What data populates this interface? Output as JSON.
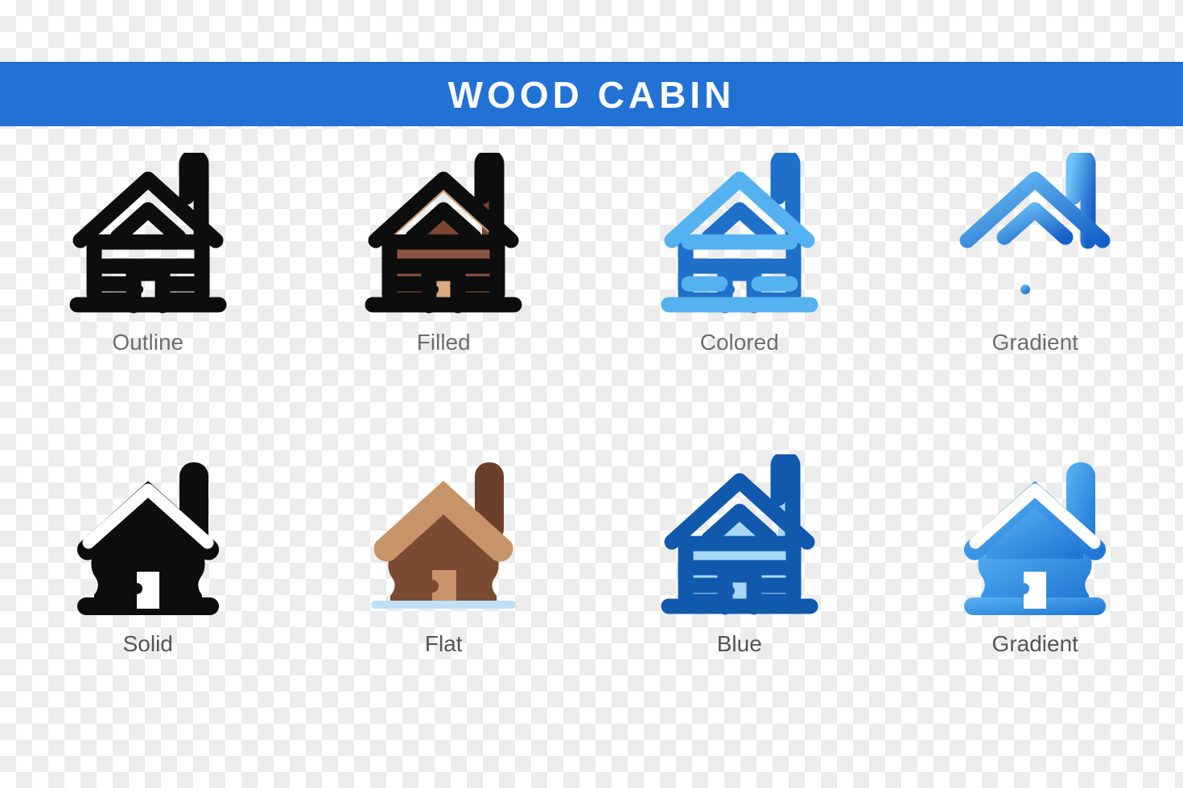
{
  "banner": {
    "title": "WOOD CABIN",
    "background_color": "#2272d6",
    "text_color": "#fdfdfd"
  },
  "background": {
    "type": "transparency-checkerboard",
    "light_color": "#ffffff",
    "dark_color": "#ececec",
    "square_size_px": 20
  },
  "icon_subject": "wood cabin",
  "grid": {
    "columns": 4,
    "rows": 2,
    "variants": [
      {
        "label": "Outline",
        "name": "wood-cabin-outline-icon",
        "stroke": "#0d0d0d",
        "fill": "none",
        "accent": "#0d0d0d"
      },
      {
        "label": "Filled",
        "name": "wood-cabin-filled-icon",
        "stroke": "#0d0d0d",
        "roof_fill": "#cb9a6e",
        "body_fill": "#8a5540",
        "chimney_fill": "#7a4631",
        "door_fill": "#d9ab7e"
      },
      {
        "label": "Colored",
        "name": "wood-cabin-colored-icon",
        "stroke": "#55b2f0",
        "accent": "#1f70c8",
        "fill": "none"
      },
      {
        "label": "Gradient",
        "name": "wood-cabin-gradient-outline-icon",
        "gradient_from": "#6ec2f5",
        "gradient_to": "#1560c8",
        "fill": "none"
      },
      {
        "label": "Solid",
        "name": "wood-cabin-solid-icon",
        "fill": "#0d0d0d",
        "cutout": "#ffffff"
      },
      {
        "label": "Flat",
        "name": "wood-cabin-flat-icon",
        "roof_fill": "#c69468",
        "body_fill": "#7a4a32",
        "chimney_fill": "#6b3f2a",
        "door_fill": "#c69468",
        "ground_fill": "#bfe0f7"
      },
      {
        "label": "Blue",
        "name": "wood-cabin-blue-icon",
        "stroke": "#1159ac",
        "fill": "#a8d8f8"
      },
      {
        "label": "Gradient",
        "name": "wood-cabin-gradient-solid-icon",
        "gradient_from": "#5ab4f2",
        "gradient_to": "#1c74d4"
      }
    ]
  }
}
